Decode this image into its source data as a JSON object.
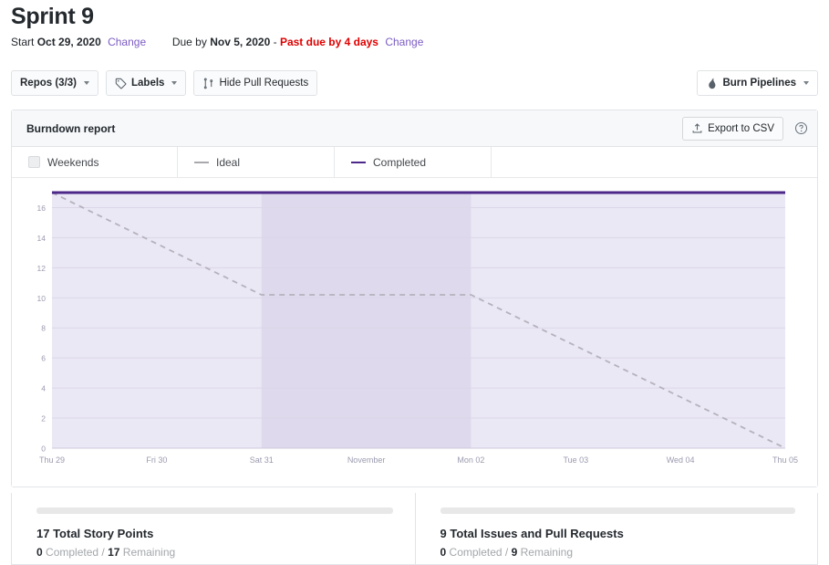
{
  "header": {
    "title": "Sprint 9",
    "start_label": "Start",
    "start_date": "Oct 29, 2020",
    "start_change": "Change",
    "due_label": "Due by",
    "due_date": "Nov 5, 2020",
    "due_separator": "-",
    "overdue": "Past due by 4 days",
    "due_change": "Change"
  },
  "toolbar": {
    "repos": "Repos (3/3)",
    "labels": "Labels",
    "hide_pull_requests": "Hide Pull Requests",
    "burn_pipelines": "Burn Pipelines"
  },
  "card": {
    "title": "Burndown report",
    "export_csv": "Export to CSV",
    "help_icon": "question-circle-icon"
  },
  "legend": {
    "weekends": "Weekends",
    "ideal": "Ideal",
    "completed": "Completed"
  },
  "summary": {
    "story_points": {
      "title": "17 Total Story Points",
      "completed_value": "0",
      "completed_label": "Completed",
      "slash": "/",
      "remaining_value": "17",
      "remaining_label": "Remaining",
      "progress_percent": 0
    },
    "issues": {
      "title": "9 Total Issues and Pull Requests",
      "completed_value": "0",
      "completed_label": "Completed",
      "slash": "/",
      "remaining_value": "9",
      "remaining_label": "Remaining",
      "progress_percent": 0
    }
  },
  "colors": {
    "accent_purple": "#6f42c1",
    "completed_line": "#4c2889",
    "ideal_line": "#b5b2bd",
    "plot_bg": "#ebe8f5",
    "weekend_bg": "#ded9ec",
    "overdue_red": "#e00000",
    "link_purple": "#7b5bc4"
  },
  "chart_data": {
    "type": "line",
    "title": "Burndown report",
    "xlabel": "",
    "ylabel": "",
    "categories": [
      "Thu 29",
      "Fri 30",
      "Sat 31",
      "November",
      "Mon 02",
      "Tue 03",
      "Wed 04",
      "Thu 05"
    ],
    "ylim": [
      0,
      17
    ],
    "yticks": [
      0,
      2,
      4,
      6,
      8,
      10,
      12,
      14,
      16
    ],
    "grid": true,
    "legend_position": "top",
    "weekend_shading": {
      "from": "Sat 31",
      "to": "Mon 02"
    },
    "series": [
      {
        "name": "Ideal",
        "style": "dashed",
        "color": "#b5b2bd",
        "values": [
          17,
          13.6,
          10.2,
          10.2,
          10.2,
          6.8,
          3.4,
          0
        ]
      },
      {
        "name": "Completed",
        "style": "solid",
        "color": "#4c2889",
        "values": [
          17,
          17,
          17,
          17,
          17,
          17,
          17,
          17
        ]
      }
    ]
  }
}
